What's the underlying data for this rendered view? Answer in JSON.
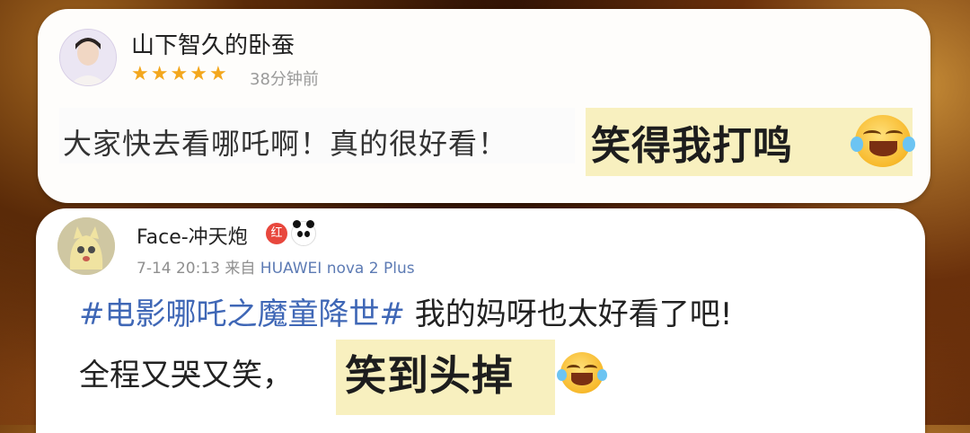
{
  "comment1": {
    "username": "山下智久的卧蚕",
    "rating": 5,
    "time": "38分钟前",
    "text": "大家快去看哪吒啊！真的很好看！",
    "highlight": "笑得我打鸣",
    "emoji": "laughing-crying-emoji"
  },
  "comment2": {
    "username": "Face-冲天炮",
    "badge_red": "红",
    "badge_icon": "panda-icon",
    "date": "7-14 20:13",
    "source_prefix": "来自",
    "device": "HUAWEI nova 2 Plus",
    "topic": "#电影哪吒之魔童降世#",
    "line1_rest": " 我的妈呀也太好看了吧!",
    "line2": "全程又哭又笑，",
    "highlight": "笑到头掉",
    "emoji": "laughing-crying-emoji"
  },
  "colors": {
    "star": "#f3a71d",
    "topic": "#3f67b6",
    "highlight": "#f8f0bf",
    "device": "#5d7bb4"
  }
}
